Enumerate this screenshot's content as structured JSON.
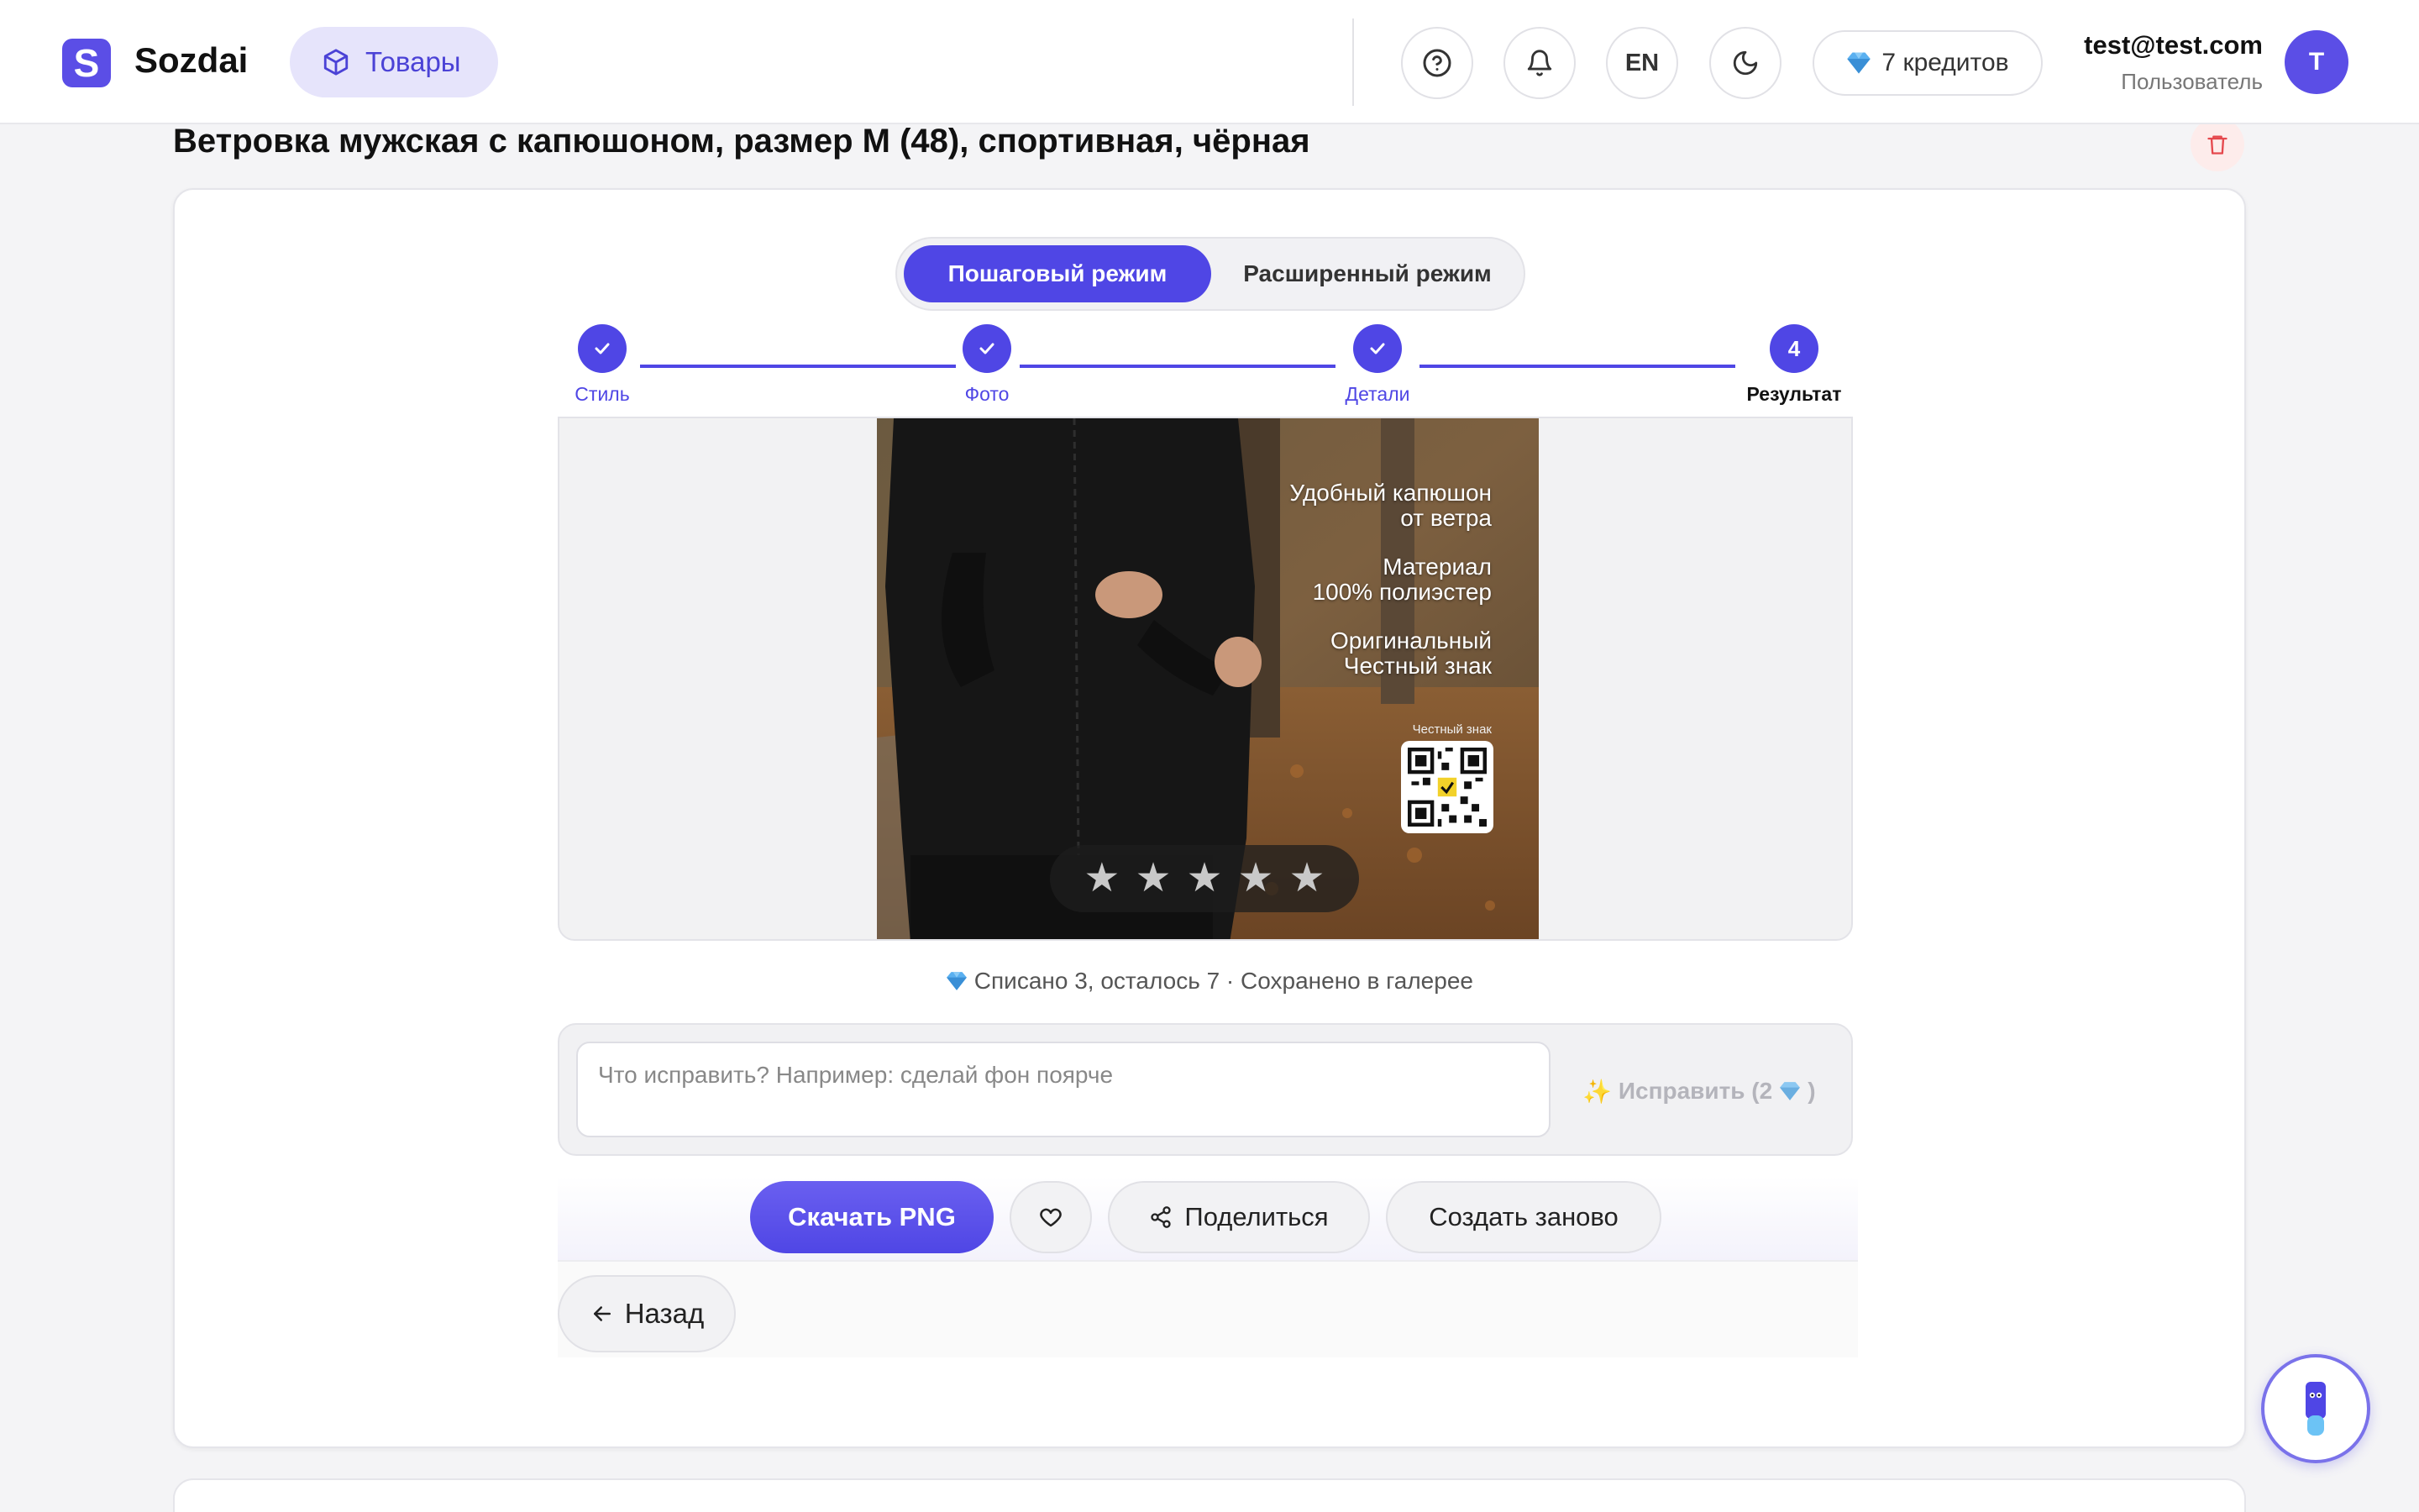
{
  "brand": {
    "name": "Sozdai",
    "logo_letter": "S"
  },
  "nav": {
    "active_label": "Товары",
    "active_icon": "box-icon"
  },
  "header": {
    "language": "EN",
    "credits_label": "7 кредитов",
    "user_email": "test@test.com",
    "user_role": "Пользователь",
    "avatar_letter": "T"
  },
  "page": {
    "title": "Ветровка мужская с капюшоном, размер M (48), спортивная, чёрная"
  },
  "mode": {
    "active": "Пошаговый режим",
    "inactive": "Расширенный режим"
  },
  "steps": [
    {
      "label": "Стиль",
      "done": true
    },
    {
      "label": "Фото",
      "done": true
    },
    {
      "label": "Детали",
      "done": true
    },
    {
      "label": "Результат",
      "number": "4",
      "current": true
    }
  ],
  "preview": {
    "features": [
      {
        "line1": "Удобный капюшон",
        "line2": "от ветра"
      },
      {
        "line1": "Материал",
        "line2": "100% полиэстер"
      },
      {
        "line1": "Оригинальный",
        "line2": "Честный знак"
      }
    ],
    "qr_label": "Честный знак",
    "rating_stars": 5
  },
  "status": {
    "text": "Списано 3, осталось 7 · Сохранено в галерее"
  },
  "fix": {
    "placeholder": "Что исправить? Например: сделай фон поярче",
    "value": "",
    "button_label": "Исправить (2"
  },
  "actions": {
    "download": "Скачать PNG",
    "share": "Поделиться",
    "recreate": "Создать заново",
    "back": "Назад"
  },
  "colors": {
    "accent": "#4f46e5",
    "accent_light": "#e6e4fb",
    "danger": "#e5484d"
  }
}
